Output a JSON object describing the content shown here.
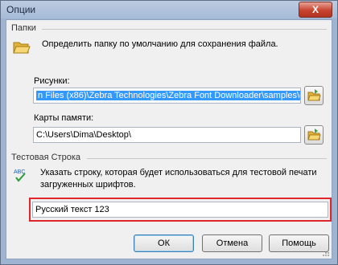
{
  "window": {
    "title": "Опции",
    "close_symbol": "X"
  },
  "folders": {
    "section_label": "Папки",
    "icon": "folder-open-icon",
    "description": "Определить папку по умолчанию для сохранения файла.",
    "pictures": {
      "label": "Рисунки:",
      "value": "n Files (x86)\\Zebra Technologies\\Zebra Font Downloader\\samples\\graphics"
    },
    "memory_cards": {
      "label": "Карты памяти:",
      "value": "C:\\Users\\Dima\\Desktop\\"
    }
  },
  "test_string": {
    "section_label": "Тестовая Строка",
    "icon": "abc-spellcheck-icon",
    "description_line1": "Указать строку, которая будет использоваться для тестовой печати",
    "description_line2": "загруженных шрифтов.",
    "value": "Русский текст 123",
    "highlight_color": "#e0262b"
  },
  "buttons": {
    "ok": "ОК",
    "cancel": "Отмена",
    "help": "Помощь"
  },
  "colors": {
    "selection": "#3399ff",
    "title_bar": "#a6bbd8",
    "dialog_bg": "#f0f0f0"
  }
}
